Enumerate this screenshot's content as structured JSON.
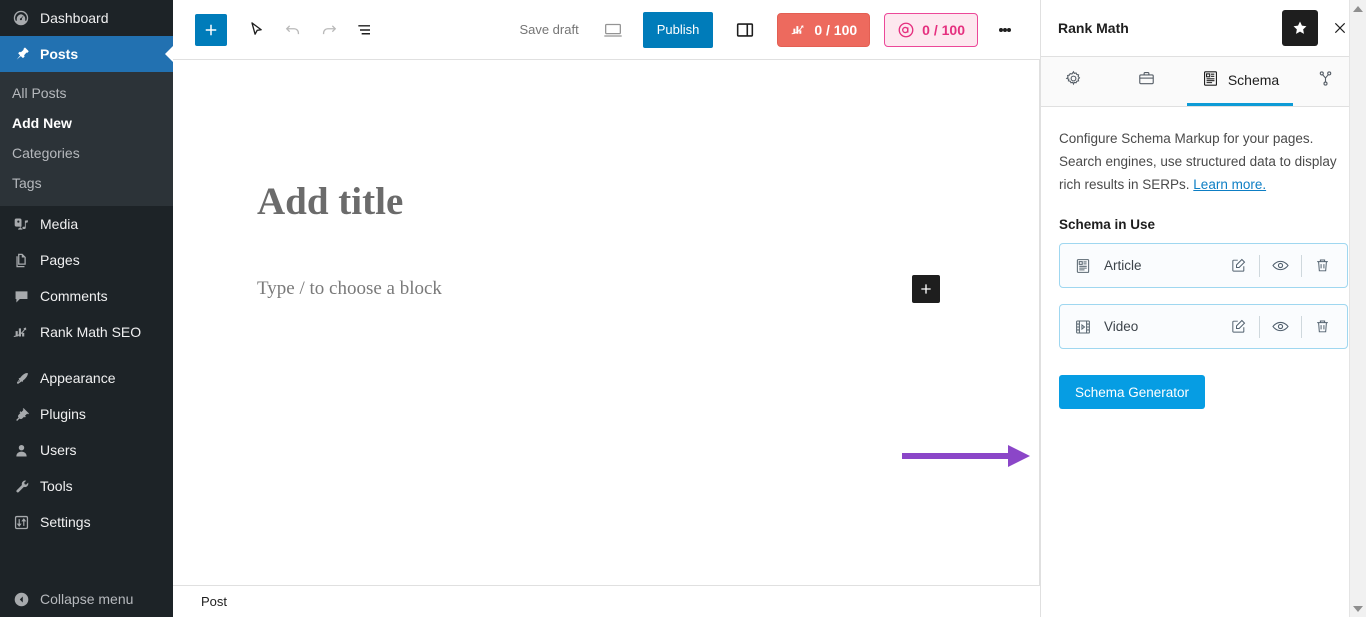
{
  "sidebar": {
    "items": [
      {
        "label": "Dashboard",
        "icon": "dashboard-icon",
        "active": false
      },
      {
        "label": "Posts",
        "icon": "pin-icon",
        "active": true
      },
      {
        "label": "Media",
        "icon": "media-icon",
        "active": false
      },
      {
        "label": "Pages",
        "icon": "pages-icon",
        "active": false
      },
      {
        "label": "Comments",
        "icon": "comments-icon",
        "active": false
      },
      {
        "label": "Rank Math SEO",
        "icon": "rank-math-icon",
        "active": false
      },
      {
        "label": "Appearance",
        "icon": "appearance-icon",
        "active": false
      },
      {
        "label": "Plugins",
        "icon": "plugins-icon",
        "active": false
      },
      {
        "label": "Users",
        "icon": "users-icon",
        "active": false
      },
      {
        "label": "Tools",
        "icon": "tools-icon",
        "active": false
      },
      {
        "label": "Settings",
        "icon": "settings-icon",
        "active": false
      }
    ],
    "posts_submenu": [
      {
        "label": "All Posts",
        "current": false
      },
      {
        "label": "Add New",
        "current": true
      },
      {
        "label": "Categories",
        "current": false
      },
      {
        "label": "Tags",
        "current": false
      }
    ],
    "collapse_label": "Collapse menu",
    "active_color": "#2271b1",
    "background_color": "#1d2327",
    "submenu_background": "#2c3338"
  },
  "toolbar": {
    "inserter_label": "+",
    "tools_icon": "cursor-tool-icon",
    "undo_icon": "undo-icon",
    "redo_icon": "redo-icon",
    "list_view_icon": "list-view-icon",
    "save_draft_label": "Save draft",
    "preview_icon": "preview-desktop-icon",
    "publish_label": "Publish",
    "settings_icon": "sidebar-settings-icon",
    "more_icon": "more-options-icon",
    "publish_color": "#007cba",
    "badges": [
      {
        "name": "seo-score-badge",
        "icon": "rank-math-icon",
        "value": "0 / 100",
        "bg": "#ed6a5e",
        "fg": "#ffffff"
      },
      {
        "name": "content-ai-score-badge",
        "icon": "content-ai-icon",
        "value": "0 / 100",
        "bg": "#fde8ef",
        "fg": "#e5307f"
      }
    ]
  },
  "editor": {
    "title_placeholder": "Add title",
    "block_placeholder": "Type / to choose a block",
    "inline_inserter_label": "+",
    "footer_breadcrumb": "Post"
  },
  "rank_math": {
    "panel_title": "Rank Math",
    "star_icon": "star-icon",
    "close_icon": "close-icon",
    "tabs": [
      {
        "label": "",
        "icon": "gear-icon",
        "name": "tab-general",
        "active": false
      },
      {
        "label": "",
        "icon": "briefcase-icon",
        "name": "tab-advanced",
        "active": false
      },
      {
        "label": "Schema",
        "icon": "schema-document-icon",
        "name": "tab-schema",
        "active": true
      },
      {
        "label": "",
        "icon": "social-share-icon",
        "name": "tab-social",
        "active": false
      }
    ],
    "description_text": "Configure Schema Markup for your pages. Search engines, use structured data to display rich results in SERPs. ",
    "learn_more_label": "Learn more.",
    "schema_in_use_label": "Schema in Use",
    "schema_items": [
      {
        "label": "Article",
        "icon": "article-icon",
        "actions": [
          "edit-icon",
          "preview-eye-icon",
          "delete-trash-icon"
        ]
      },
      {
        "label": "Video",
        "icon": "video-film-icon",
        "actions": [
          "edit-icon",
          "preview-eye-icon",
          "delete-trash-icon"
        ]
      }
    ],
    "generator_button_label": "Schema Generator",
    "generator_button_color": "#069de3",
    "active_tab_underline_color": "#0d9bd6"
  },
  "annotation": {
    "arrow_color": "#8b46c8",
    "points_to": "Schema Generator"
  }
}
